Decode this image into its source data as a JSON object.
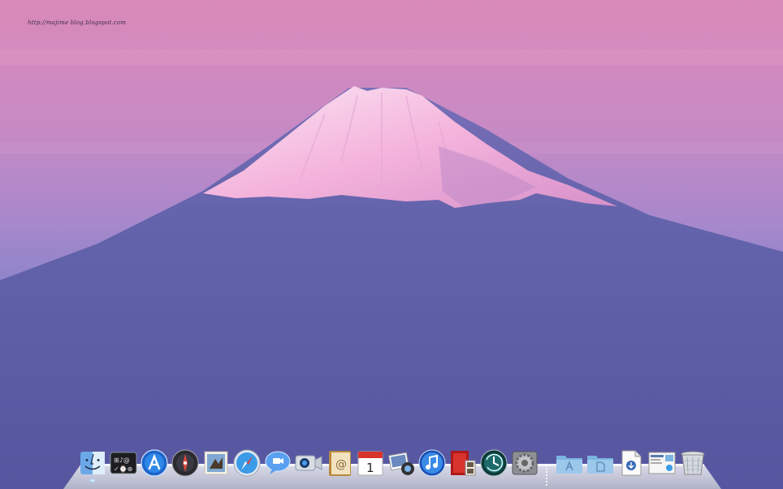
{
  "desktop": {
    "watermark": "http://majime blog.blogspot.com",
    "wallpaper": "mount-fuji-at-dusk",
    "colors": {
      "sky_top": "#d98ab8",
      "sky_mid": "#b58ac9",
      "mountain": "#5a5aa0",
      "snow": "#f6bfe3"
    }
  },
  "dock": {
    "items": [
      {
        "name": "finder",
        "icon": "finder-icon",
        "running": true
      },
      {
        "name": "dashboard",
        "icon": "dashboard-icon",
        "running": false
      },
      {
        "name": "app-store",
        "icon": "app-store-icon",
        "running": false
      },
      {
        "name": "launchpad",
        "icon": "launchpad-icon",
        "running": false
      },
      {
        "name": "mail",
        "icon": "mail-stamp-icon",
        "running": false
      },
      {
        "name": "safari",
        "icon": "safari-compass-icon",
        "running": false
      },
      {
        "name": "ichat",
        "icon": "ichat-bubble-icon",
        "running": false
      },
      {
        "name": "facetime",
        "icon": "facetime-camera-icon",
        "running": false
      },
      {
        "name": "address-book",
        "icon": "address-book-icon",
        "running": false
      },
      {
        "name": "ical",
        "icon": "calendar-icon",
        "running": false,
        "day": "1"
      },
      {
        "name": "iphoto",
        "icon": "iphoto-icon",
        "running": false
      },
      {
        "name": "itunes",
        "icon": "itunes-note-icon",
        "running": false
      },
      {
        "name": "photo-booth",
        "icon": "photo-booth-icon",
        "running": false
      },
      {
        "name": "time-machine",
        "icon": "time-machine-icon",
        "running": false
      },
      {
        "name": "system-preferences",
        "icon": "gear-icon",
        "running": false
      },
      {
        "name": "applications-stack",
        "icon": "applications-folder-icon",
        "running": false
      },
      {
        "name": "documents-stack",
        "icon": "documents-folder-icon",
        "running": false
      },
      {
        "name": "downloads-stack",
        "icon": "downloads-file-icon",
        "running": false
      },
      {
        "name": "screenshot-stack",
        "icon": "screenshot-file-icon",
        "running": false
      },
      {
        "name": "trash",
        "icon": "trash-icon",
        "running": false
      }
    ]
  }
}
